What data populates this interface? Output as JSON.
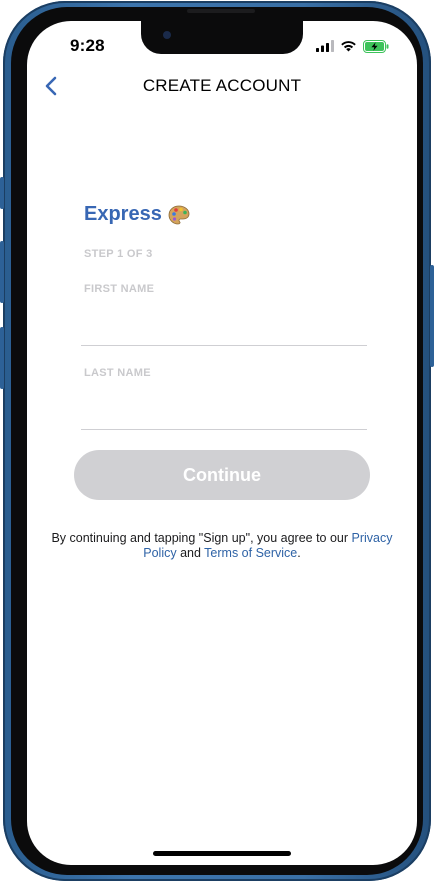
{
  "status_bar": {
    "time": "9:28",
    "icons": [
      "cellular-signal-icon",
      "wifi-icon",
      "battery-charging-icon"
    ],
    "battery_color": "#3dc35a"
  },
  "nav": {
    "back_icon": "chevron-left-icon",
    "title": "CREATE ACCOUNT",
    "accent": "#3867b4"
  },
  "brand": {
    "name": "Express",
    "emoji": "🎨"
  },
  "form": {
    "step": "STEP 1 OF 3",
    "first_name_label": "FIRST NAME",
    "first_name_value": "",
    "last_name_label": "LAST NAME",
    "last_name_value": ""
  },
  "actions": {
    "continue_label": "Continue",
    "continue_disabled_color": "#d0d0d3"
  },
  "legal": {
    "prefix": "By continuing and tapping \"Sign up\", you agree to our ",
    "privacy_link": "Privacy Policy",
    "middle": " and ",
    "terms_link": "Terms of Service",
    "suffix": ".",
    "link_color": "#2f63a6"
  }
}
